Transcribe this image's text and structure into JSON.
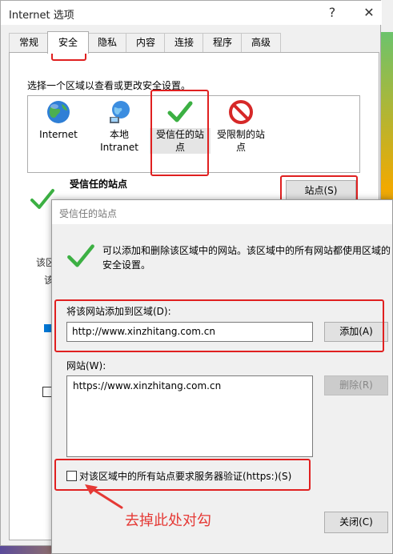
{
  "window": {
    "title": "Internet 选项",
    "help_glyph": "?",
    "close_glyph": "✕",
    "tabs": [
      "常规",
      "安全",
      "隐私",
      "内容",
      "连接",
      "程序",
      "高级"
    ],
    "active_tab": "安全"
  },
  "security": {
    "prompt": "选择一个区域以查看或更改安全设置。",
    "zones": [
      {
        "label": "Internet",
        "icon": "globe-icon"
      },
      {
        "label": "本地\nIntranet",
        "icon": "network-globe-icon"
      },
      {
        "label": "受信任的站\n点",
        "icon": "green-check-icon"
      },
      {
        "label": "受限制的站\n点",
        "icon": "red-prohibited-icon"
      }
    ],
    "selected_zone_title": "受信任的站点",
    "sites_button": "站点(S)",
    "partial_labels": [
      "该区",
      "该"
    ]
  },
  "trusted_dialog": {
    "title": "受信任的站点",
    "description": "可以添加和删除该区域中的网站。该区域中的所有网站都使用区域的安全设置。",
    "add_label": "将该网站添加到区域(D):",
    "add_value": "http://www.xinzhitang.com.cn",
    "add_button": "添加(A)",
    "sites_label": "网站(W):",
    "sites": [
      "https://www.xinzhitang.com.cn"
    ],
    "remove_button": "删除(R)",
    "https_checkbox_label": "对该区域中的所有站点要求服务器验证(https:)(S)",
    "https_checked": false,
    "close_button": "关闭(C)"
  },
  "annotation": {
    "text": "去掉此处对勾",
    "color": "#e53935"
  }
}
